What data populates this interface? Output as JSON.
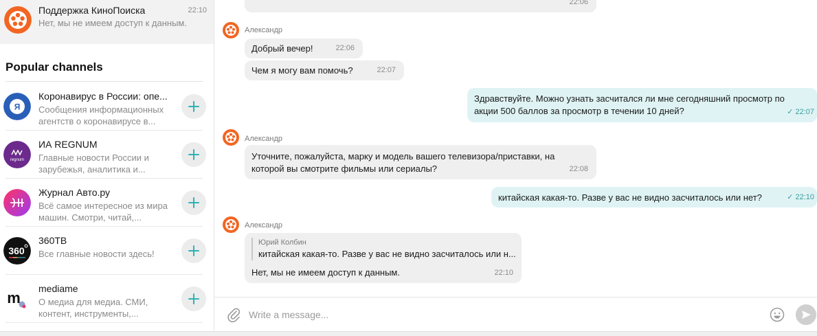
{
  "pinned_chat": {
    "name": "Поддержка КиноПоиска",
    "time": "22:10",
    "preview": "Нет, мы не имеем доступ к данным."
  },
  "sidebar": {
    "section_title": "Popular channels",
    "channels": [
      {
        "name": "Коронавирус в России: опе...",
        "desc": "Сообщения информационных агентств о коронавирусе в...",
        "icon": "yandex-logo-icon"
      },
      {
        "name": "ИА REGNUM",
        "desc": "Главные новости России и зарубежья, аналитика и...",
        "icon": "regnum-logo-icon"
      },
      {
        "name": "Журнал Авто.ру",
        "desc": "Всё самое интересное из мира машин. Смотри, читай,...",
        "icon": "autoru-logo-icon"
      },
      {
        "name": "360ТВ",
        "desc": "Все главные новости здесь!",
        "icon": "360tv-logo-icon"
      },
      {
        "name": "mediame",
        "desc": "О медиа для медиа. СМИ, контент, инструменты,...",
        "icon": "mediame-logo-icon"
      }
    ]
  },
  "chat": {
    "top_bubble_time": "22:06",
    "messages": [
      {
        "sender": "Александр",
        "text": "Добрый вечер!",
        "time": "22:06"
      },
      {
        "text": "Чем я могу вам помочь?",
        "time": "22:07"
      },
      {
        "outgoing": true,
        "line1": "Здравствуйте. Можно узнать засчитался ли мне сегодняшний просмотр по",
        "line2": "акции 500 баллов за просмотр в течении 10 дней?",
        "time": "22:07"
      },
      {
        "sender": "Александр",
        "line1": "Уточните, пожалуйста, марку и модель вашего телевизора/приставки, на",
        "line2": "которой вы смотрите фильмы или сериалы?",
        "time": "22:08"
      },
      {
        "outgoing": true,
        "text": "китайская какая-то. Разве у вас не видно засчиталось или нет?",
        "time": "22:10"
      },
      {
        "sender": "Александр",
        "quote_name": "Юрий Колбин",
        "quote_text": "китайская какая-то. Разве у вас не видно засчиталось или н...",
        "text": "Нет, мы не имеем доступ к данным.",
        "time": "22:10"
      }
    ],
    "read_mark": "✓"
  },
  "composer": {
    "placeholder": "Write a message..."
  },
  "colors": {
    "brand_orange": "#f26522",
    "accent_teal": "#2bb3b5",
    "outgoing_bubble": "#dff3f4",
    "incoming_bubble": "#efefef"
  }
}
